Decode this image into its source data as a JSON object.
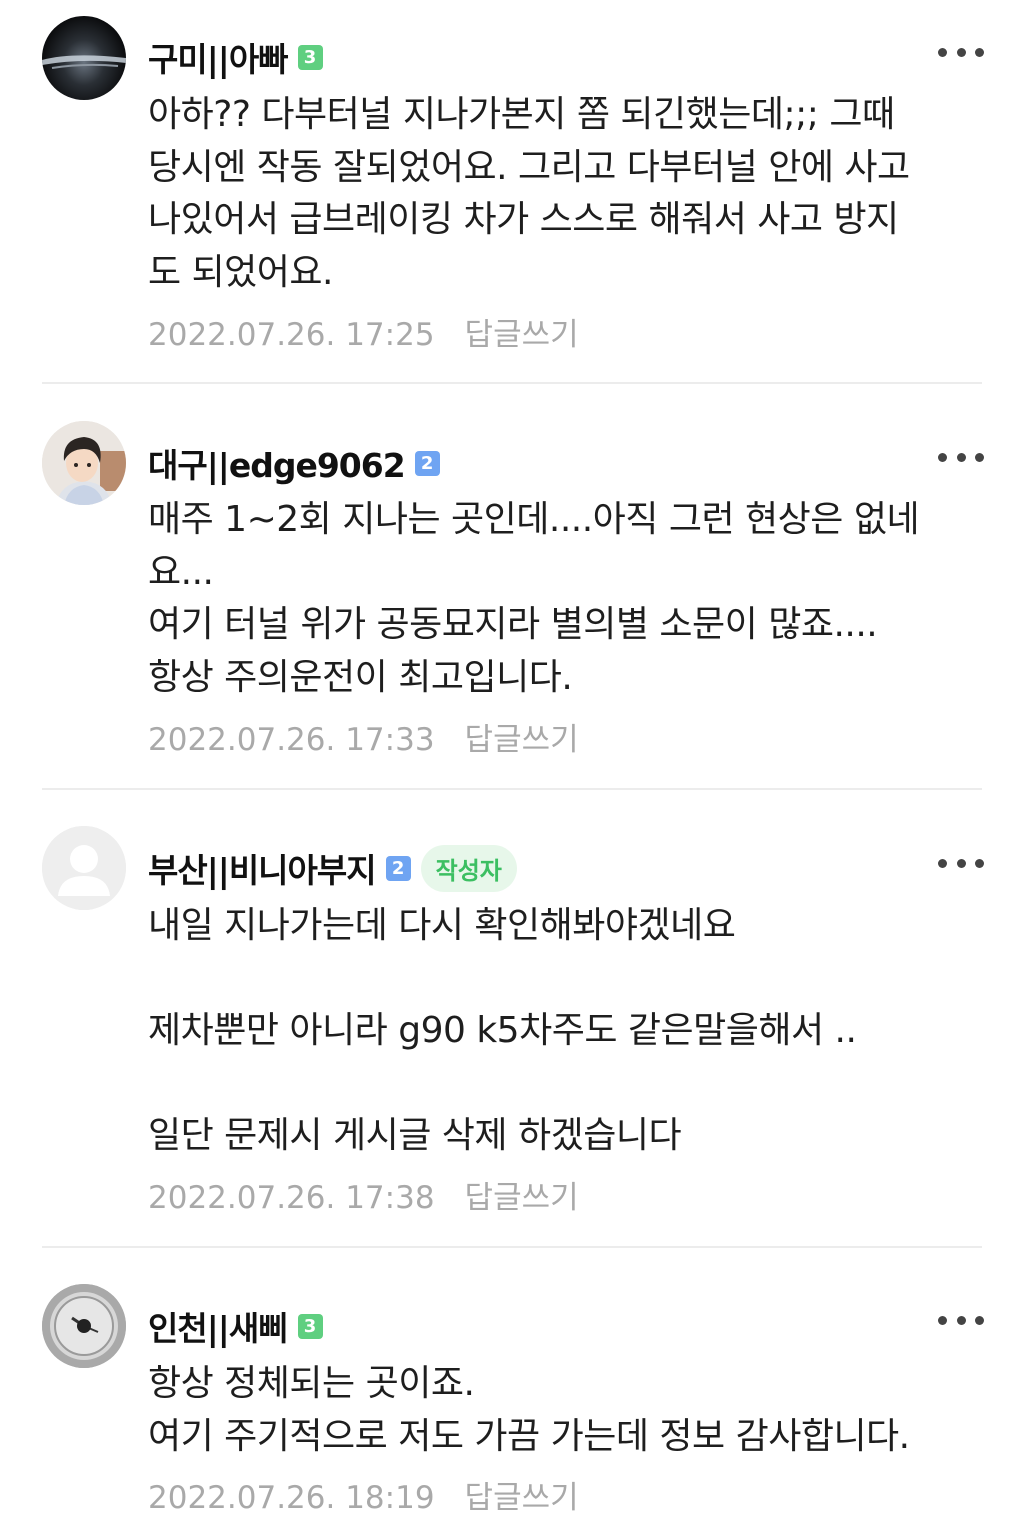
{
  "comments": [
    {
      "nickname": "구미||아빠",
      "grade": "3",
      "lines": [
        "아하?? 다부터널 지나가본지 쫌 되긴했는데;;; 그때",
        "당시엔 작동 잘되었어요. 그리고 다부터널 안에 사고",
        "나있어서 급브레이킹 차가 스스로 해줘서 사고 방지",
        "도 되었어요."
      ],
      "date": "2022.07.26. 17:25",
      "reply_label": "답글쓰기"
    },
    {
      "nickname": "대구||edge9062",
      "grade": "2",
      "lines": [
        "매주 1~2회 지나는 곳인데....아직 그런 현상은 없네",
        "요...",
        "여기 터널 위가 공동묘지라 별의별 소문이 많죠....",
        "항상 주의운전이 최고입니다."
      ],
      "date": "2022.07.26. 17:33",
      "reply_label": "답글쓰기"
    },
    {
      "nickname": "부산||비니아부지",
      "grade": "2",
      "author_badge": "작성자",
      "lines": [
        "내일 지나가는데 다시 확인해봐야겠네요",
        "",
        "제차뿐만 아니라 g90 k5차주도 같은말을해서 ..",
        "",
        "일단 문제시 게시글 삭제 하겠습니다"
      ],
      "date": "2022.07.26. 17:38",
      "reply_label": "답글쓰기"
    },
    {
      "nickname": "인천||새삐",
      "grade": "3",
      "lines": [
        "항상 정체되는 곳이죠.",
        "여기 주기적으로 저도 가끔 가는데 정보 감사합니다."
      ],
      "date": "2022.07.26. 18:19",
      "reply_label": "답글쓰기"
    }
  ],
  "icons": {
    "more": "more-horizontal-icon"
  },
  "colors": {
    "grade3": "#5fcf80",
    "grade2": "#6fa4f2",
    "author_badge_text": "#3cbf62",
    "meta_text": "#a9a9a9"
  }
}
